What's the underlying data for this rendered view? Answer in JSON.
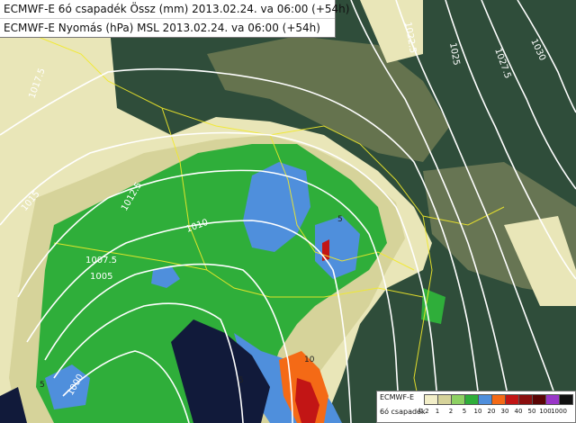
{
  "header": {
    "line1": "ECMWF-E 6ó csapadék Össz (mm) 2013.02.24. va 06:00 (+54h)",
    "line2": "ECMWF-E Nyomás (hPa) MSL 2013.02.24. va 06:00 (+54h)"
  },
  "isobar_labels": [
    "1030",
    "1027.5",
    "1025",
    "1022.5",
    "1017.5",
    "1015",
    "1012.5",
    "1010",
    "1007.5",
    "1005",
    "1000"
  ],
  "precip_labels": [
    "5",
    "5",
    "10",
    "5"
  ],
  "legend": {
    "title": "ECMWF-E",
    "unit": "6ó csapadék",
    "thresholds": [
      "0.2",
      "1",
      "2",
      "5",
      "10",
      "20",
      "30",
      "40",
      "50",
      "100",
      "1000"
    ],
    "colors": [
      "#f2eec8",
      "#d6d39a",
      "#8ed163",
      "#2fae3a",
      "#4f8fdc",
      "#f46a16",
      "#c21515",
      "#8a0e0e",
      "#5a0404",
      "#9a36c8",
      "#111111"
    ]
  },
  "colors": {
    "terrain_dark": "#2f4d3a",
    "terrain_light": "#8d8f70",
    "light_precip": "#e9e6b8",
    "precip_1mm": "#d6d39a",
    "precip_2mm": "#2fae3a",
    "precip_5mm": "#4f8fdc",
    "precip_10mm": "#f46a16",
    "precip_20mm": "#c21515",
    "sea": "#111a3a",
    "isobar": "#ffffff",
    "border": "#f2ea2a"
  }
}
